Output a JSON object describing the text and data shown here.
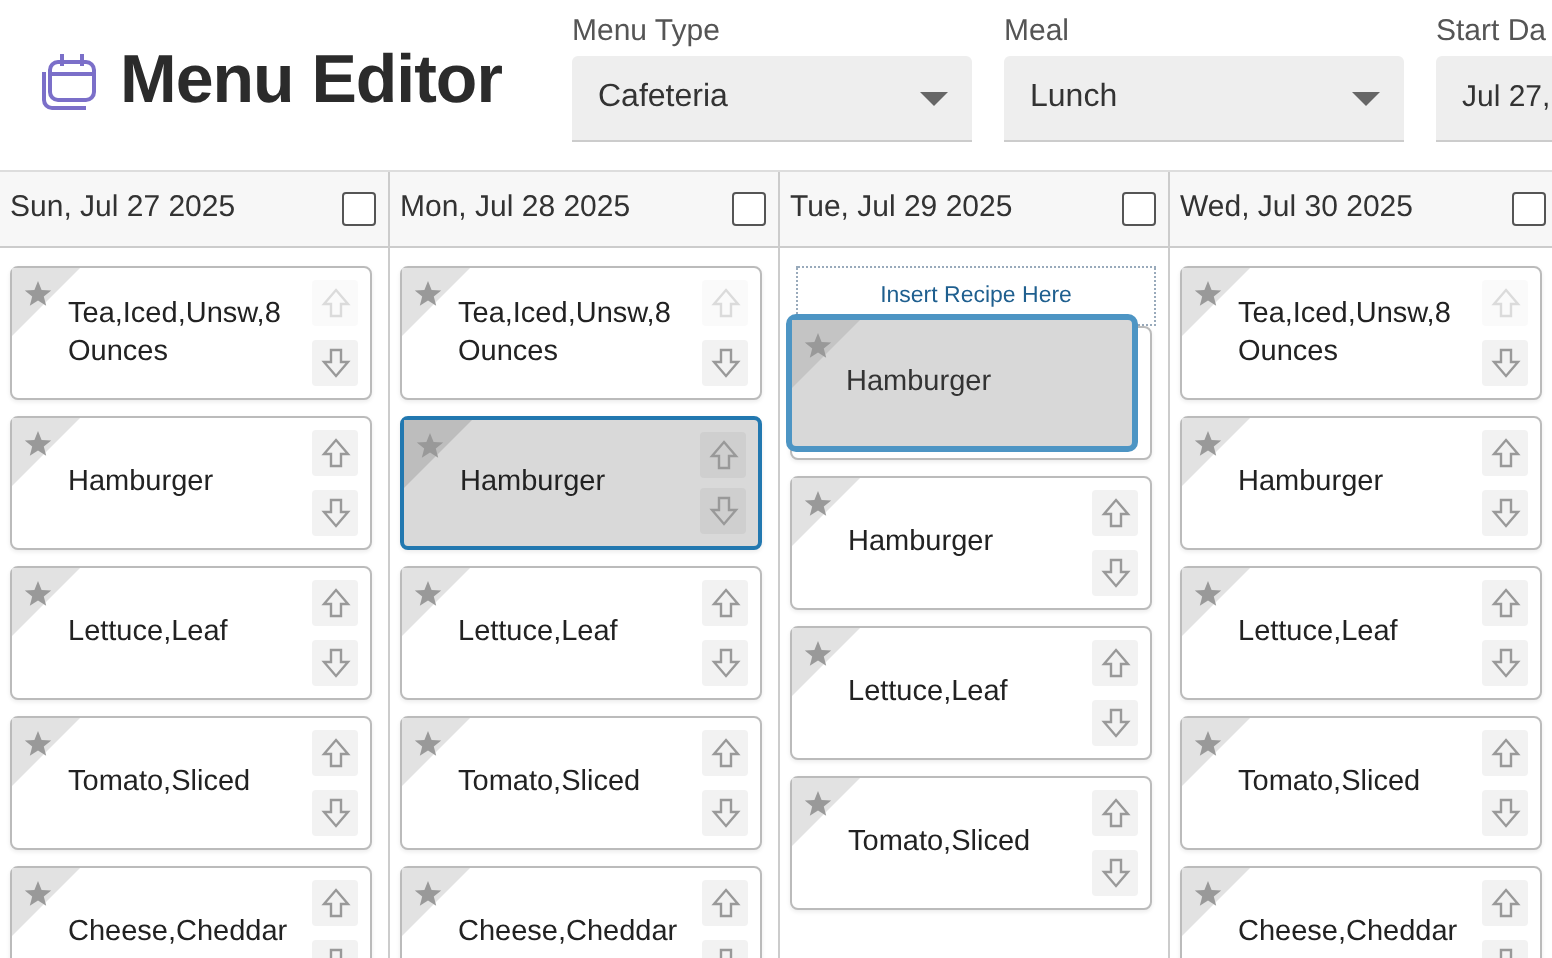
{
  "title": "Menu Editor",
  "filters": [
    {
      "label": "Menu Type",
      "value": "Cafeteria",
      "cut_off": false
    },
    {
      "label": "Meal",
      "value": "Lunch",
      "cut_off": false
    },
    {
      "label": "Start Da",
      "value": "Jul 27,",
      "cut_off": true
    }
  ],
  "days": [
    {
      "date": "Sun, Jul 27 2025",
      "checked": false,
      "items": [
        {
          "name": "Tea,Iced,Unsw,8 Ounces",
          "up_disabled": true,
          "selected": false
        },
        {
          "name": "Hamburger",
          "up_disabled": false,
          "selected": false
        },
        {
          "name": "Lettuce,Leaf",
          "up_disabled": false,
          "selected": false
        },
        {
          "name": "Tomato,Sliced",
          "up_disabled": false,
          "selected": false
        },
        {
          "name": "Cheese,Cheddar",
          "up_disabled": false,
          "selected": false
        }
      ]
    },
    {
      "date": "Mon, Jul 28 2025",
      "checked": false,
      "items": [
        {
          "name": "Tea,Iced,Unsw,8 Ounces",
          "up_disabled": true,
          "selected": false
        },
        {
          "name": "Hamburger",
          "up_disabled": false,
          "selected": true
        },
        {
          "name": "Lettuce,Leaf",
          "up_disabled": false,
          "selected": false
        },
        {
          "name": "Tomato,Sliced",
          "up_disabled": false,
          "selected": false
        },
        {
          "name": "Cheese,Cheddar",
          "up_disabled": false,
          "selected": false
        }
      ]
    },
    {
      "date": "Tue, Jul 29 2025",
      "checked": false,
      "drop_hint": "Insert Recipe Here",
      "dragging": {
        "name": "Hamburger"
      },
      "items": [
        {
          "selected": false
        },
        {
          "name": "Hamburger",
          "up_disabled": false,
          "selected": false
        },
        {
          "name": "Lettuce,Leaf",
          "up_disabled": false,
          "selected": false
        },
        {
          "name": "Tomato,Sliced",
          "up_disabled": false,
          "selected": false
        }
      ]
    },
    {
      "date": "Wed, Jul 30 2025",
      "checked": false,
      "items": [
        {
          "name": "Tea,Iced,Unsw,8 Ounces",
          "up_disabled": true,
          "selected": false
        },
        {
          "name": "Hamburger",
          "up_disabled": false,
          "selected": false
        },
        {
          "name": "Lettuce,Leaf",
          "up_disabled": false,
          "selected": false
        },
        {
          "name": "Tomato,Sliced",
          "up_disabled": false,
          "selected": false
        },
        {
          "name": "Cheese,Cheddar",
          "up_disabled": false,
          "selected": false
        }
      ]
    }
  ]
}
